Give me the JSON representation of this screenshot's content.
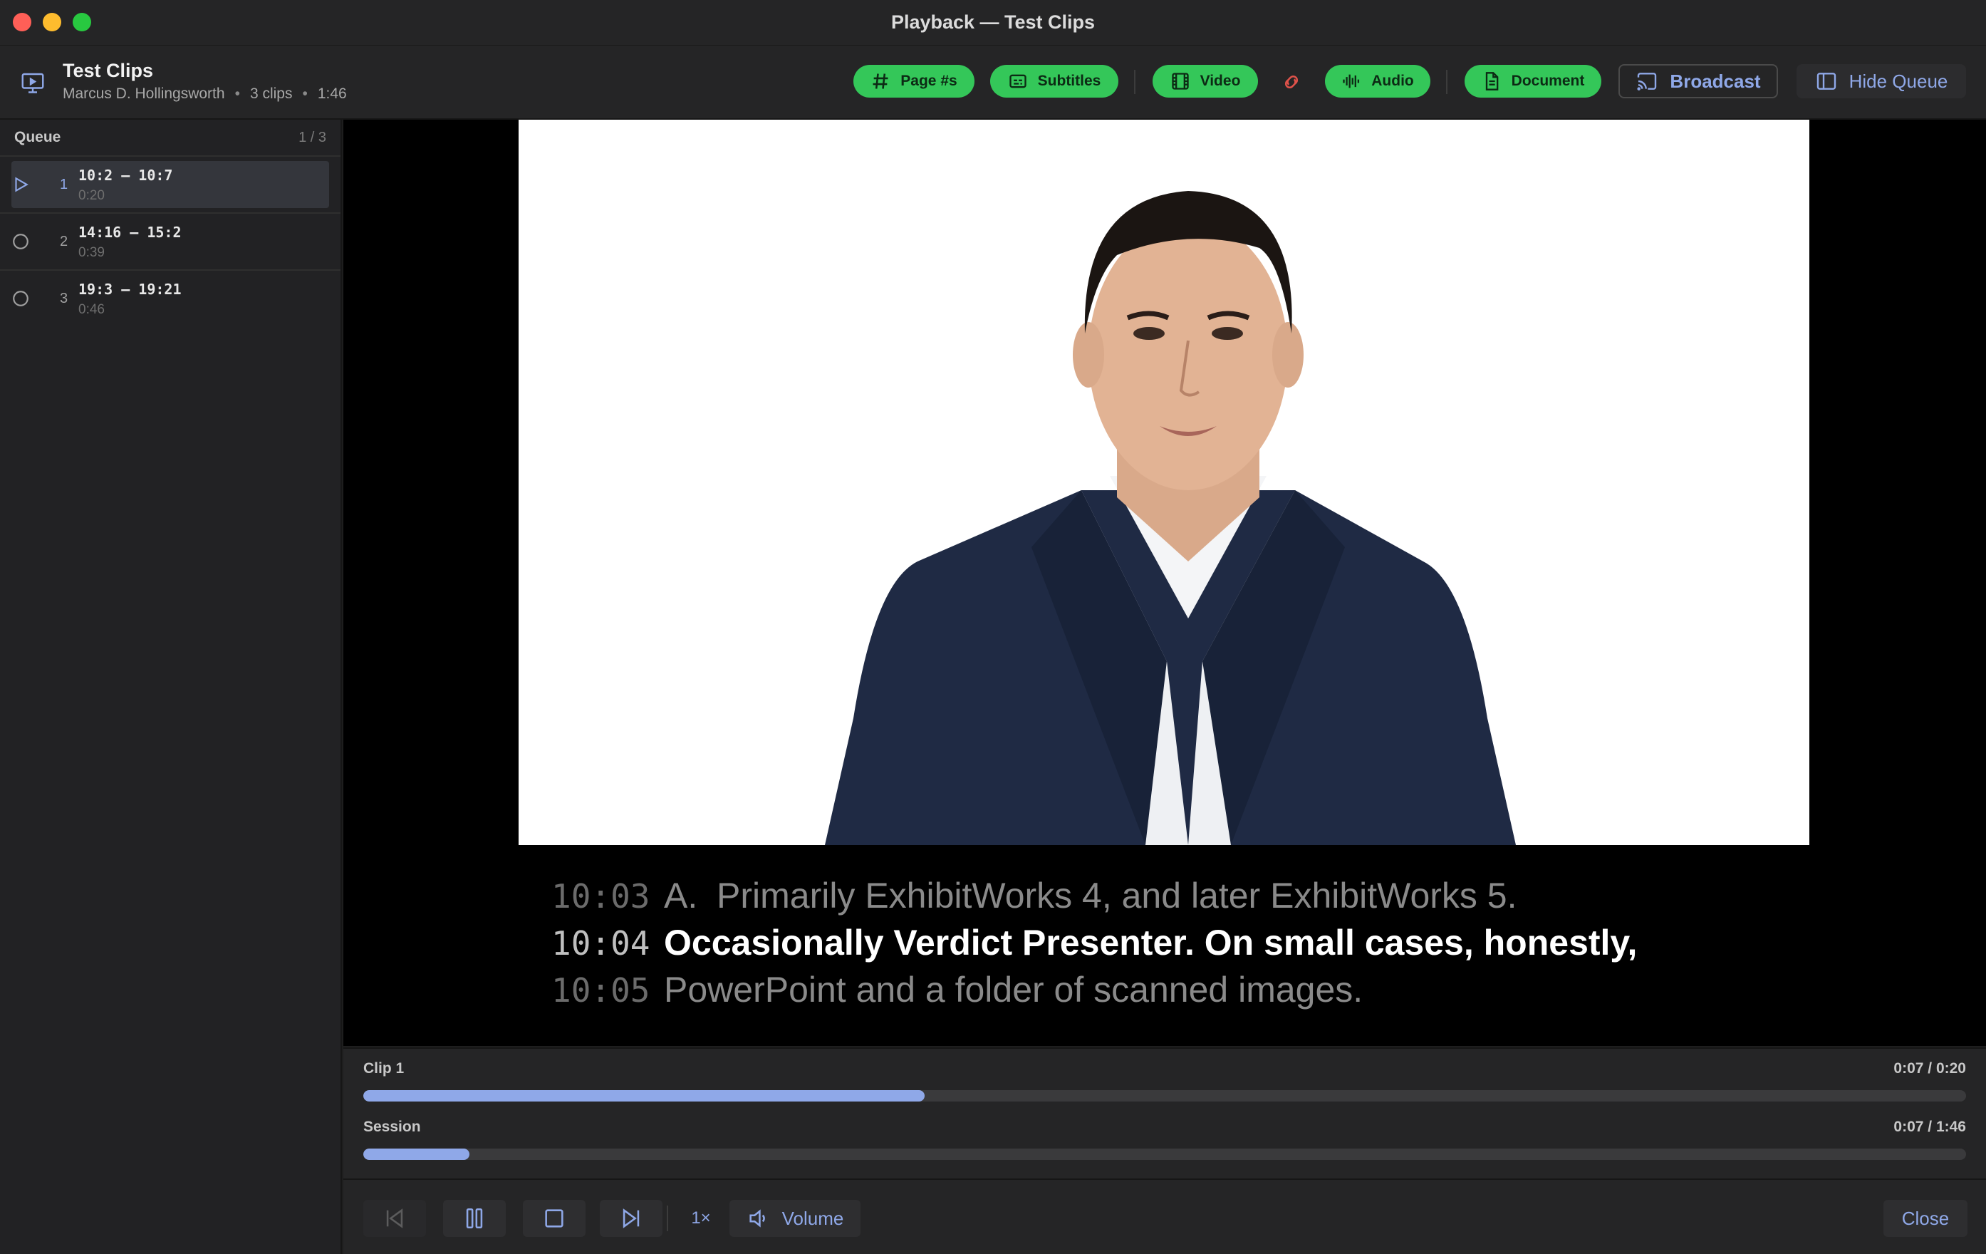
{
  "window": {
    "title": "Playback — Test Clips"
  },
  "header": {
    "title": "Test Clips",
    "subtitle": {
      "name": "Marcus D. Hollingsworth",
      "clips": "3 clips",
      "duration": "1:46"
    },
    "toggles": {
      "page_numbers": "Page #s",
      "subtitles": "Subtitles",
      "video": "Video",
      "audio": "Audio",
      "document": "Document"
    },
    "broadcast_label": "Broadcast",
    "hide_queue_label": "Hide Queue"
  },
  "queue": {
    "title": "Queue",
    "count": "1 / 3",
    "items": [
      {
        "index": "1",
        "range": "10:2 — 10:7",
        "duration": "0:20",
        "state": "playing"
      },
      {
        "index": "2",
        "range": "14:16 — 15:2",
        "duration": "0:39",
        "state": "pending"
      },
      {
        "index": "3",
        "range": "19:3 — 19:21",
        "duration": "0:46",
        "state": "pending"
      }
    ]
  },
  "transcript": {
    "lines": [
      {
        "time": "10:03",
        "prefix": "A.",
        "text": "Primarily ExhibitWorks 4, and later ExhibitWorks 5."
      },
      {
        "time": "10:04",
        "prefix": "",
        "text": "Occasionally Verdict Presenter. On small cases, honestly,"
      },
      {
        "time": "10:05",
        "prefix": "",
        "text": "PowerPoint and a folder of scanned images."
      }
    ]
  },
  "progress": {
    "clip": {
      "label": "Clip 1",
      "time": "0:07 / 0:20",
      "fraction": 0.35
    },
    "session": {
      "label": "Session",
      "time": "0:07 / 1:46",
      "fraction": 0.066
    }
  },
  "controls": {
    "speed_label": "1×",
    "volume_label": "Volume",
    "close_label": "Close"
  },
  "colors": {
    "accent": "#8fa8e8",
    "toggle_on": "#34c759",
    "muted_indicator": "#e0524a"
  }
}
